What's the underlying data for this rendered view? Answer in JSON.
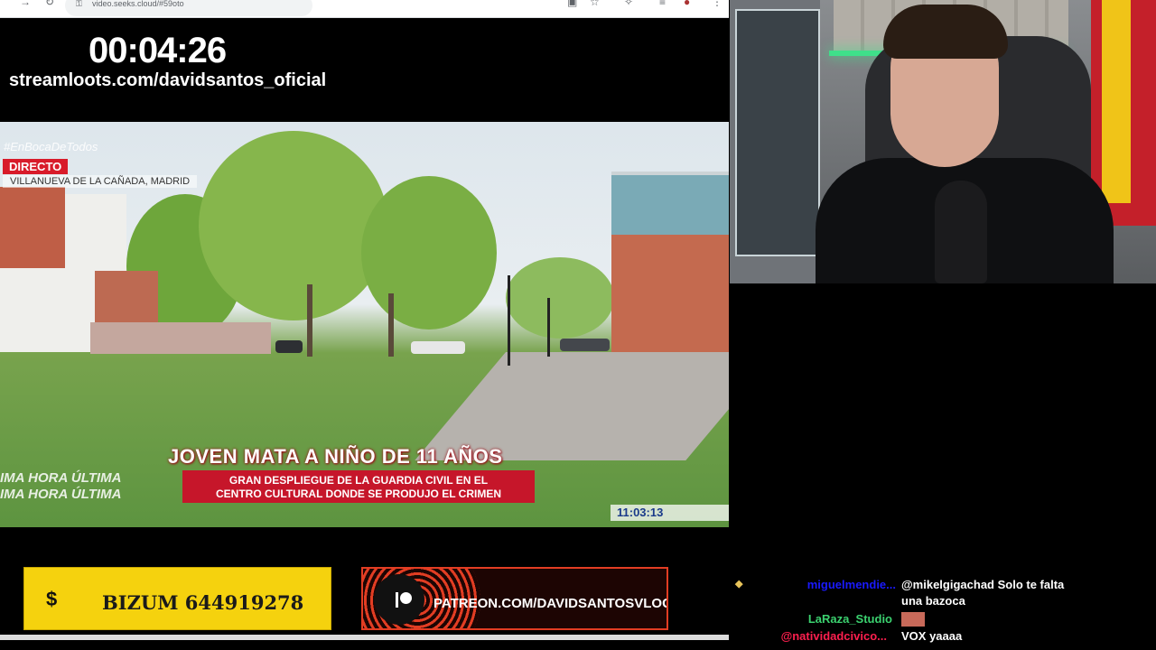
{
  "browser": {
    "url": "video.seeks.cloud/#59oto",
    "back_icon": "arrow-left-icon",
    "reload_icon": "reload-icon",
    "star_icon": "star-icon",
    "extensions_icon": "puzzle-icon"
  },
  "stream": {
    "timer": "00:04:26",
    "streamloots": "streamloots.com/davidsantos_oficial"
  },
  "news": {
    "hashtag": "#EnBocaDeTodos",
    "live_badge": "DIRECTO",
    "location": "VILLANUEVA DE LA CAÑADA, MADRID",
    "headline": "JOVEN MATA A NIÑO DE 11 AÑOS",
    "subline_1": "GRAN DESPLIEGUE DE LA GUARDIA CIVIL EN EL",
    "subline_2": "CENTRO CULTURAL DONDE SE PRODUJO EL CRIMEN",
    "ticker_1": "IMA HORA    ÚLTIMA",
    "ticker_2": "IMA HORA    ÚLTIMA",
    "clock": "11:03:13"
  },
  "banners": {
    "bizum_icon": "$",
    "bizum": "BIZUM 644919278",
    "patreon": "PATREON.COM/DAVIDSANTOSVLOG"
  },
  "chat": [
    {
      "user": "miguelmendie...",
      "user_color": "#1a1aff",
      "message_1": "@mikelgigachad Solo te falta",
      "message_2": "una bazoca"
    },
    {
      "user": "LaRaza_Studio",
      "user_color": "#3bd16f",
      "message_1": "",
      "message_2": ""
    },
    {
      "user": "@natividadcivico...",
      "user_color": "#ff1f4f",
      "message_1": "VOX yaaaa",
      "message_2": ""
    }
  ],
  "colors": {
    "accent_red": "#d81b2a",
    "bizum_yellow": "#f5d20e",
    "patreon_orange": "#e23d23"
  }
}
